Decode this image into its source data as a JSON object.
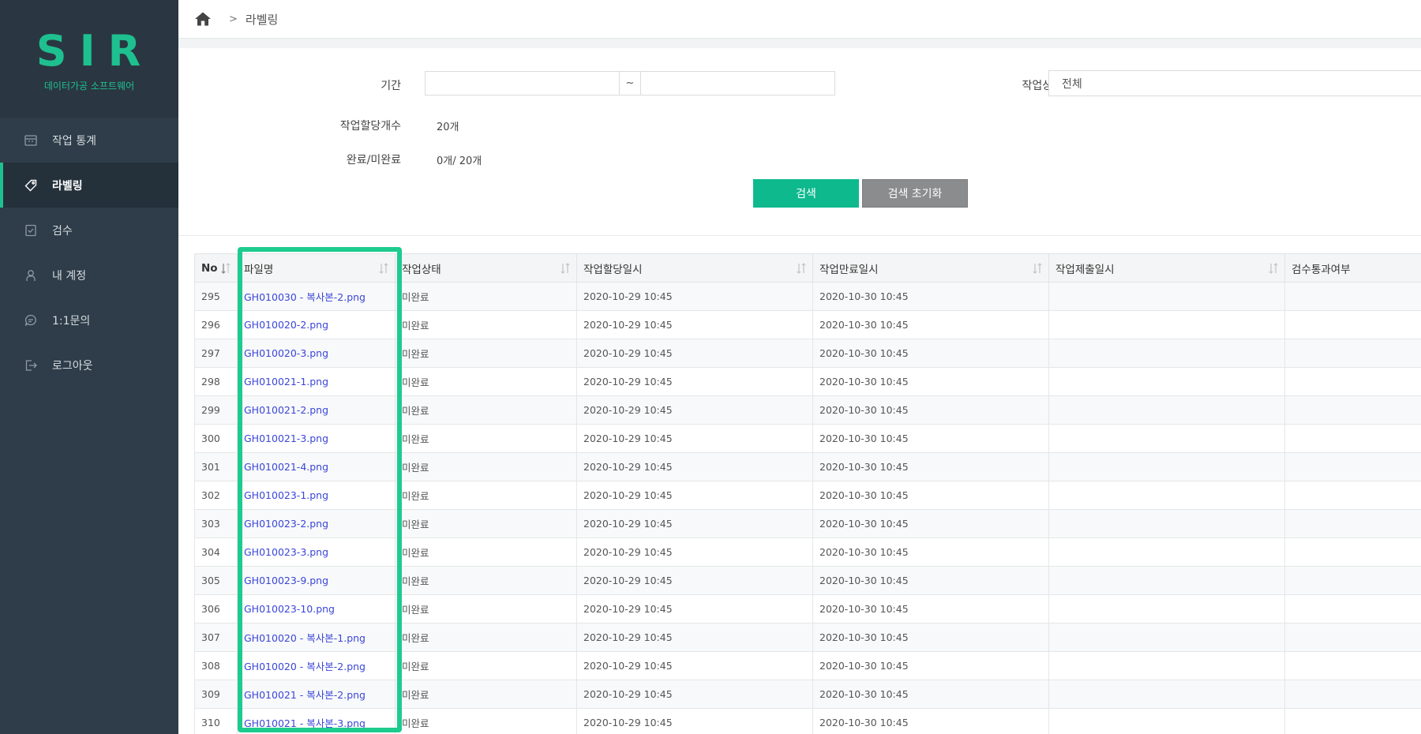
{
  "sidebar": {
    "logo_title": "SIR",
    "logo_subtitle": "데이터가공 소프트웨어",
    "items": [
      {
        "label": "작업 통계",
        "icon": "calendar-icon",
        "active": false
      },
      {
        "label": "라벨링",
        "icon": "tag-icon",
        "active": true
      },
      {
        "label": "검수",
        "icon": "checkbox-icon",
        "active": false
      },
      {
        "label": "내 계정",
        "icon": "user-icon",
        "active": false
      },
      {
        "label": "1:1문의",
        "icon": "chat-icon",
        "active": false
      },
      {
        "label": "로그아웃",
        "icon": "logout-icon",
        "active": false
      }
    ]
  },
  "header": {
    "breadcrumb_separator": ">",
    "breadcrumb_current": "라벨링"
  },
  "filter": {
    "period_label": "기간",
    "period_start": "",
    "period_separator": "~",
    "period_end": "",
    "status_label": "작업상태",
    "status_value": "전체",
    "assigned_count_label": "작업할당개수",
    "assigned_count_value": "20개",
    "completion_label": "완료/미완료",
    "completion_value": "0개/ 20개",
    "search_button": "검색",
    "reset_button": "검색 초기화"
  },
  "table": {
    "columns": [
      "No",
      "파일명",
      "작업상태",
      "작업할당일시",
      "작업만료일시",
      "작업제출일시",
      "검수통과여부"
    ],
    "rows": [
      {
        "no": "295",
        "file": "GH010030 - 복사본-2.png",
        "status": "미완료",
        "assigned": "2020-10-29 10:45",
        "expires": "2020-10-30 10:45",
        "submitted": "",
        "passed": ""
      },
      {
        "no": "296",
        "file": "GH010020-2.png",
        "status": "미완료",
        "assigned": "2020-10-29 10:45",
        "expires": "2020-10-30 10:45",
        "submitted": "",
        "passed": ""
      },
      {
        "no": "297",
        "file": "GH010020-3.png",
        "status": "미완료",
        "assigned": "2020-10-29 10:45",
        "expires": "2020-10-30 10:45",
        "submitted": "",
        "passed": ""
      },
      {
        "no": "298",
        "file": "GH010021-1.png",
        "status": "미완료",
        "assigned": "2020-10-29 10:45",
        "expires": "2020-10-30 10:45",
        "submitted": "",
        "passed": ""
      },
      {
        "no": "299",
        "file": "GH010021-2.png",
        "status": "미완료",
        "assigned": "2020-10-29 10:45",
        "expires": "2020-10-30 10:45",
        "submitted": "",
        "passed": ""
      },
      {
        "no": "300",
        "file": "GH010021-3.png",
        "status": "미완료",
        "assigned": "2020-10-29 10:45",
        "expires": "2020-10-30 10:45",
        "submitted": "",
        "passed": ""
      },
      {
        "no": "301",
        "file": "GH010021-4.png",
        "status": "미완료",
        "assigned": "2020-10-29 10:45",
        "expires": "2020-10-30 10:45",
        "submitted": "",
        "passed": ""
      },
      {
        "no": "302",
        "file": "GH010023-1.png",
        "status": "미완료",
        "assigned": "2020-10-29 10:45",
        "expires": "2020-10-30 10:45",
        "submitted": "",
        "passed": ""
      },
      {
        "no": "303",
        "file": "GH010023-2.png",
        "status": "미완료",
        "assigned": "2020-10-29 10:45",
        "expires": "2020-10-30 10:45",
        "submitted": "",
        "passed": ""
      },
      {
        "no": "304",
        "file": "GH010023-3.png",
        "status": "미완료",
        "assigned": "2020-10-29 10:45",
        "expires": "2020-10-30 10:45",
        "submitted": "",
        "passed": ""
      },
      {
        "no": "305",
        "file": "GH010023-9.png",
        "status": "미완료",
        "assigned": "2020-10-29 10:45",
        "expires": "2020-10-30 10:45",
        "submitted": "",
        "passed": ""
      },
      {
        "no": "306",
        "file": "GH010023-10.png",
        "status": "미완료",
        "assigned": "2020-10-29 10:45",
        "expires": "2020-10-30 10:45",
        "submitted": "",
        "passed": ""
      },
      {
        "no": "307",
        "file": "GH010020 - 복사본-1.png",
        "status": "미완료",
        "assigned": "2020-10-29 10:45",
        "expires": "2020-10-30 10:45",
        "submitted": "",
        "passed": ""
      },
      {
        "no": "308",
        "file": "GH010020 - 복사본-2.png",
        "status": "미완료",
        "assigned": "2020-10-29 10:45",
        "expires": "2020-10-30 10:45",
        "submitted": "",
        "passed": ""
      },
      {
        "no": "309",
        "file": "GH010021 - 복사본-2.png",
        "status": "미완료",
        "assigned": "2020-10-29 10:45",
        "expires": "2020-10-30 10:45",
        "submitted": "",
        "passed": ""
      },
      {
        "no": "310",
        "file": "GH010021 - 복사본-3.png",
        "status": "미완료",
        "assigned": "2020-10-29 10:45",
        "expires": "2020-10-30 10:45",
        "submitted": "",
        "passed": ""
      }
    ]
  },
  "colors": {
    "brand_green": "#1ec08f",
    "sidebar_bg": "#2e3d49",
    "link_blue": "#3a46d8",
    "highlight_green": "#1dcb8f"
  }
}
